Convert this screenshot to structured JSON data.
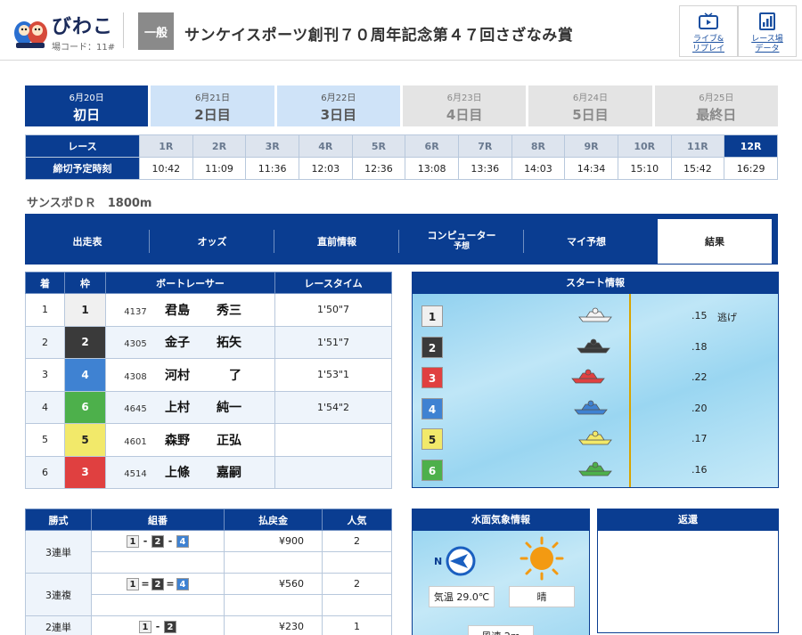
{
  "header": {
    "venue_name": "びわこ",
    "venue_code": "場コード：11#",
    "grade": "一般",
    "race_title": "サンケイスポーツ創刊７０周年記念第４７回さざなみ賞",
    "links": [
      {
        "label1": "ライブ&",
        "label2": "リプレイ",
        "icon": "tv-icon"
      },
      {
        "label1": "レース場",
        "label2": "データ",
        "icon": "bar-chart-icon"
      }
    ]
  },
  "days": [
    {
      "date": "6月20日",
      "label": "初日",
      "state": "active"
    },
    {
      "date": "6月21日",
      "label": "2日目",
      "state": "near"
    },
    {
      "date": "6月22日",
      "label": "3日目",
      "state": "near"
    },
    {
      "date": "6月23日",
      "label": "4日目",
      "state": "far"
    },
    {
      "date": "6月24日",
      "label": "5日目",
      "state": "far"
    },
    {
      "date": "6月25日",
      "label": "最終日",
      "state": "far"
    }
  ],
  "race_table": {
    "race_header": "レース",
    "time_header": "締切予定時刻",
    "races": [
      "1R",
      "2R",
      "3R",
      "4R",
      "5R",
      "6R",
      "7R",
      "8R",
      "9R",
      "10R",
      "11R",
      "12R"
    ],
    "times": [
      "10:42",
      "11:09",
      "11:36",
      "12:03",
      "12:36",
      "13:08",
      "13:36",
      "14:03",
      "14:34",
      "15:10",
      "15:42",
      "16:29"
    ],
    "selected": "12R"
  },
  "course": "サンスポＤＲ　1800m",
  "content_tabs": [
    {
      "label": "出走表",
      "sub": ""
    },
    {
      "label": "オッズ",
      "sub": ""
    },
    {
      "label": "直前情報",
      "sub": ""
    },
    {
      "label": "コンピューター",
      "sub": "予想"
    },
    {
      "label": "マイ予想",
      "sub": ""
    },
    {
      "label": "結果",
      "sub": ""
    }
  ],
  "result": {
    "headers": [
      "着",
      "枠",
      "ボートレーサー",
      "レースタイム"
    ],
    "rows": [
      {
        "rank": "1",
        "waku": "1",
        "reg": "4137",
        "last": "君島",
        "first": "秀三",
        "time": "1'50\"7"
      },
      {
        "rank": "2",
        "waku": "2",
        "reg": "4305",
        "last": "金子",
        "first": "拓矢",
        "time": "1'51\"7"
      },
      {
        "rank": "3",
        "waku": "4",
        "reg": "4308",
        "last": "河村",
        "first": "了",
        "time": "1'53\"1"
      },
      {
        "rank": "4",
        "waku": "6",
        "reg": "4645",
        "last": "上村",
        "first": "純一",
        "time": "1'54\"2"
      },
      {
        "rank": "5",
        "waku": "5",
        "reg": "4601",
        "last": "森野",
        "first": "正弘",
        "time": ""
      },
      {
        "rank": "6",
        "waku": "3",
        "reg": "4514",
        "last": "上條",
        "first": "嘉嗣",
        "time": ""
      }
    ]
  },
  "start_info": {
    "title": "スタート情報",
    "rows": [
      {
        "waku": "1",
        "st": ".15",
        "kimarite": "逃げ",
        "boat_offset": 0.55
      },
      {
        "waku": "2",
        "st": ".18",
        "kimarite": "",
        "boat_offset": 0.53
      },
      {
        "waku": "3",
        "st": ".22",
        "kimarite": "",
        "boat_offset": 0.47
      },
      {
        "waku": "4",
        "st": ".20",
        "kimarite": "",
        "boat_offset": 0.5
      },
      {
        "waku": "5",
        "st": ".17",
        "kimarite": "",
        "boat_offset": 0.55
      },
      {
        "waku": "6",
        "st": ".16",
        "kimarite": "",
        "boat_offset": 0.55
      }
    ]
  },
  "payout": {
    "headers": [
      "勝式",
      "組番",
      "払戻金",
      "人気"
    ],
    "rows": [
      {
        "kind": "3連単",
        "combo": [
          "1",
          "2",
          "4"
        ],
        "sep": "-",
        "amount": "¥900",
        "pop": "2"
      },
      {
        "kind": "3連複",
        "combo": [
          "1",
          "2",
          "4"
        ],
        "sep": "=",
        "amount": "¥560",
        "pop": "2"
      },
      {
        "kind": "2連単",
        "combo": [
          "1",
          "2"
        ],
        "sep": "-",
        "amount": "¥230",
        "pop": "1"
      }
    ]
  },
  "weather": {
    "title": "水面気象情報",
    "compass_label": "N",
    "temp": "気温 29.0℃",
    "condition": "晴",
    "wind": "風速 2m"
  },
  "henkan": {
    "title": "返還"
  },
  "colors": {
    "primary": "#0a3d91",
    "waku1": "#f0f0f0",
    "waku2": "#3a3a3a",
    "waku3": "#e04040",
    "waku4": "#3f82d2",
    "waku5": "#f2e96a",
    "waku6": "#4db04b"
  }
}
